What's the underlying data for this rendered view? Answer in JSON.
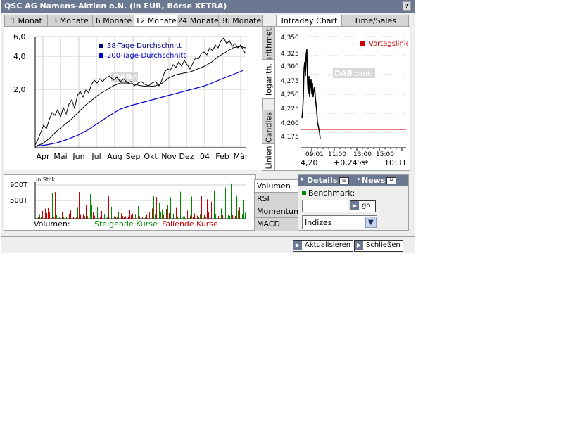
{
  "window": {
    "title": "QSC AG Namens-Aktien o.N. (in EUR, Börse XETRA)",
    "help_label": "?"
  },
  "period_tabs": [
    {
      "label": "1 Monat",
      "active": false
    },
    {
      "label": "3 Monate",
      "active": false
    },
    {
      "label": "6 Monate",
      "active": false
    },
    {
      "label": "12 Monate",
      "active": true
    },
    {
      "label": "24 Monate",
      "active": false
    },
    {
      "label": "36 Monate",
      "active": false
    }
  ],
  "main_chart": {
    "y_ticks": [
      "6,0",
      "4,0",
      "2,0"
    ],
    "x_ticks": [
      "Apr",
      "Mai",
      "Jun",
      "Jul",
      "Aug",
      "Sep",
      "Okt",
      "Nov",
      "Dez",
      "04",
      "Feb",
      "Mär"
    ],
    "legend": [
      {
        "label": "38-Tage-Durchschnitt",
        "color": "#000080"
      },
      {
        "label": "200-Tage-Durchschnitt",
        "color": "#0000cc"
      }
    ],
    "watermark_left": "DAB",
    "watermark_right": "bank"
  },
  "scale_tabs": [
    {
      "label": "arithmet.",
      "active": false
    },
    {
      "label": "logarith.",
      "active": true
    },
    {
      "label": "Candles",
      "active": false
    },
    {
      "label": "Linien",
      "active": true
    }
  ],
  "intraday": {
    "tabs": [
      {
        "label": "Intraday Chart",
        "active": true
      },
      {
        "label": "Time/Sales",
        "active": false
      }
    ],
    "y_ticks": [
      "4,350",
      "4,325",
      "4,300",
      "4,275",
      "4,250",
      "4,225",
      "4,200",
      "4,175"
    ],
    "x_ticks": [
      "09:01",
      "11:00",
      "13:00",
      "15:00"
    ],
    "legend_label": "Vortagslinie",
    "legend_color": "#cc0000",
    "watermark_left": "DAB",
    "watermark_right": "bank",
    "price": "4,20",
    "change": "+0,24%",
    "change_arrow": "⇨",
    "time": "10:31"
  },
  "volume_chart": {
    "unit": "in Stck",
    "y_ticks": [
      "900T",
      "500T"
    ],
    "footer_label": "Volumen:",
    "rising_label": "Steigende Kurse",
    "rising_color": "#008800",
    "falling_label": "Fallende Kurse",
    "falling_color": "#cc0000"
  },
  "indicator_tabs": [
    {
      "label": "Volumen",
      "active": true
    },
    {
      "label": "RSI",
      "active": false
    },
    {
      "label": "Momentum",
      "active": false
    },
    {
      "label": "MACD",
      "active": false
    }
  ],
  "details": {
    "details_label": "Details",
    "news_label": "News",
    "benchmark_label": "Benchmark:",
    "benchmark_value": "",
    "go_label": "go!",
    "select_value": "Indizes"
  },
  "footer": {
    "refresh_label": "Aktualisieren",
    "close_label": "Schließen"
  }
}
